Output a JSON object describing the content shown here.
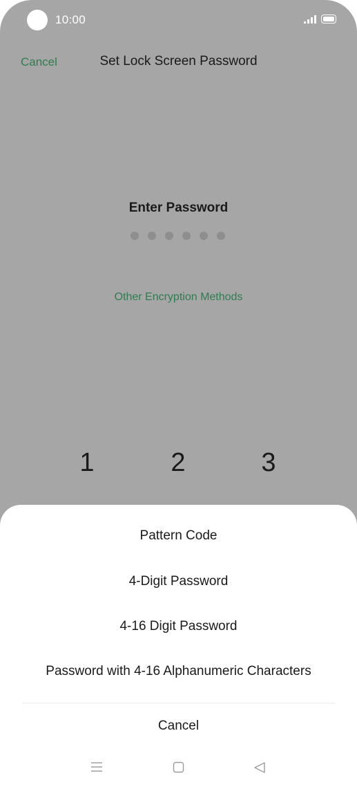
{
  "status_bar": {
    "time": "10:00"
  },
  "header": {
    "cancel_label": "Cancel",
    "title": "Set Lock Screen Password"
  },
  "password": {
    "prompt": "Enter Password",
    "dot_count": 6,
    "other_methods_label": "Other Encryption Methods"
  },
  "keypad": {
    "keys": [
      "1",
      "2",
      "3"
    ]
  },
  "sheet": {
    "options": [
      "Pattern Code",
      "4-Digit Password",
      "4-16 Digit Password",
      "Password with 4-16 Alphanumeric Characters"
    ],
    "cancel_label": "Cancel"
  },
  "nav_bar": {
    "icons": [
      "menu-icon",
      "home-icon",
      "back-icon"
    ]
  },
  "colors": {
    "accent_green": "#2e7d4f",
    "overlay_gray": "#a6a6a6",
    "sheet_bg": "#ffffff"
  }
}
